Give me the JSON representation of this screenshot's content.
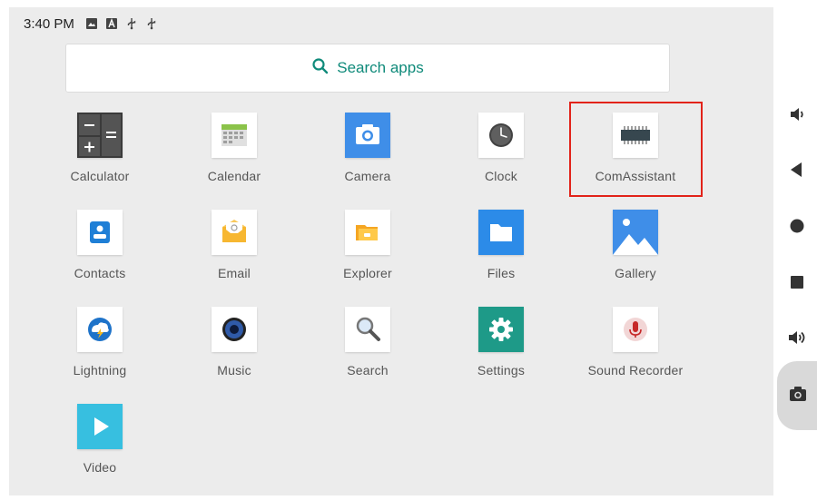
{
  "status_bar": {
    "time": "3:40 PM",
    "icons": [
      "image-icon",
      "font-icon",
      "usb-icon",
      "usb-icon"
    ]
  },
  "search": {
    "placeholder": "Search apps",
    "icon": "search-icon",
    "accent_color": "#0f8a7a"
  },
  "apps": [
    {
      "id": "calculator",
      "label": "Calculator",
      "icon": "calculator-icon"
    },
    {
      "id": "calendar",
      "label": "Calendar",
      "icon": "calendar-icon"
    },
    {
      "id": "camera",
      "label": "Camera",
      "icon": "camera-icon"
    },
    {
      "id": "clock",
      "label": "Clock",
      "icon": "clock-icon"
    },
    {
      "id": "comassistant",
      "label": "ComAssistant",
      "icon": "chip-icon",
      "highlighted": true
    },
    {
      "id": "contacts",
      "label": "Contacts",
      "icon": "contacts-icon"
    },
    {
      "id": "email",
      "label": "Email",
      "icon": "email-icon"
    },
    {
      "id": "explorer",
      "label": "Explorer",
      "icon": "folder-open-icon"
    },
    {
      "id": "files",
      "label": "Files",
      "icon": "folder-icon"
    },
    {
      "id": "gallery",
      "label": "Gallery",
      "icon": "gallery-icon"
    },
    {
      "id": "lightning",
      "label": "Lightning",
      "icon": "lightning-icon"
    },
    {
      "id": "music",
      "label": "Music",
      "icon": "speaker-icon"
    },
    {
      "id": "search",
      "label": "Search",
      "icon": "magnifier-icon"
    },
    {
      "id": "settings",
      "label": "Settings",
      "icon": "gear-icon"
    },
    {
      "id": "sound_recorder",
      "label": "Sound Recorder",
      "icon": "microphone-icon"
    },
    {
      "id": "video",
      "label": "Video",
      "icon": "play-icon"
    }
  ],
  "nav_buttons": [
    {
      "id": "volume-down",
      "icon": "volume-down-icon"
    },
    {
      "id": "back",
      "icon": "back-icon"
    },
    {
      "id": "home",
      "icon": "home-icon"
    },
    {
      "id": "recents",
      "icon": "recents-icon"
    },
    {
      "id": "volume-up",
      "icon": "volume-up-icon"
    },
    {
      "id": "screenshot",
      "icon": "screenshot-icon"
    }
  ],
  "colors": {
    "highlight": "#e2231a",
    "background": "#ececec"
  }
}
